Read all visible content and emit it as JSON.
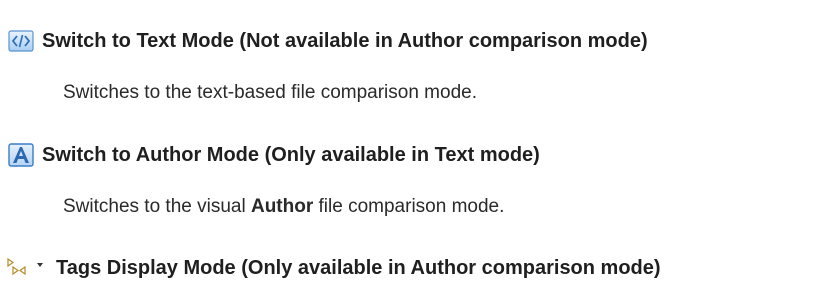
{
  "entries": [
    {
      "icon": "text-mode-icon",
      "title": "Switch to Text Mode (Not available in Author comparison mode)",
      "description": "Switches to the text-based file comparison mode."
    },
    {
      "icon": "author-mode-icon",
      "title": "Switch to Author Mode (Only available in Text mode)",
      "description_prefix": "Switches to the visual ",
      "description_bold": "Author",
      "description_suffix": " file comparison mode."
    },
    {
      "icon": "tags-display-mode-icon",
      "title": "Tags Display Mode (Only available in Author comparison mode)"
    }
  ],
  "colors": {
    "icon_blue": "#3a7fd0",
    "icon_light": "#d6e8fb",
    "tag_icon": "#c08a1e"
  }
}
